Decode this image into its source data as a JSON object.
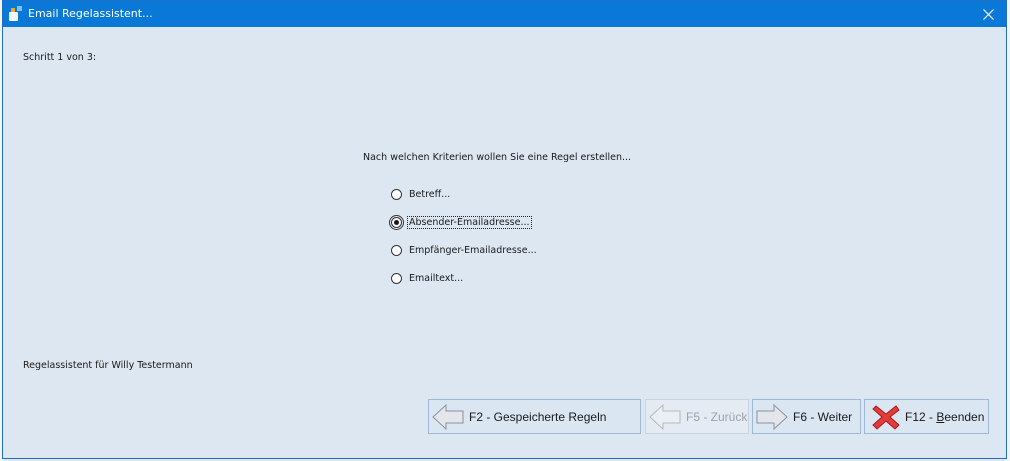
{
  "window": {
    "title": "Email Regelassistent..."
  },
  "step_label": "Schritt 1 von 3:",
  "question": "Nach welchen Kriterien wollen Sie eine Regel erstellen...",
  "options": [
    {
      "label": "Betreff...",
      "selected": false
    },
    {
      "label": "Absender-Emailadresse...",
      "selected": true
    },
    {
      "label": "Empfänger-Emailadresse...",
      "selected": false
    },
    {
      "label": "Emailtext...",
      "selected": false
    }
  ],
  "footer": "Regelassistent für Willy Testermann",
  "buttons": {
    "saved_rules": "F2 - Gespeicherte Regeln",
    "back": "F5 - Zurück",
    "next": "F6 - Weiter",
    "quit_prefix": "F12 - ",
    "quit_underlined": "B",
    "quit_rest": "eenden"
  },
  "colors": {
    "titlebar": "#0a78d7",
    "client": "#dde7f2",
    "button": "#dbe6f3",
    "close_red": "#e23b3b"
  },
  "icons": {
    "app": "app-icon",
    "close": "close-icon",
    "back_arrow": "arrow-left-icon",
    "forward_arrow": "arrow-right-icon",
    "quit": "red-x-icon"
  }
}
